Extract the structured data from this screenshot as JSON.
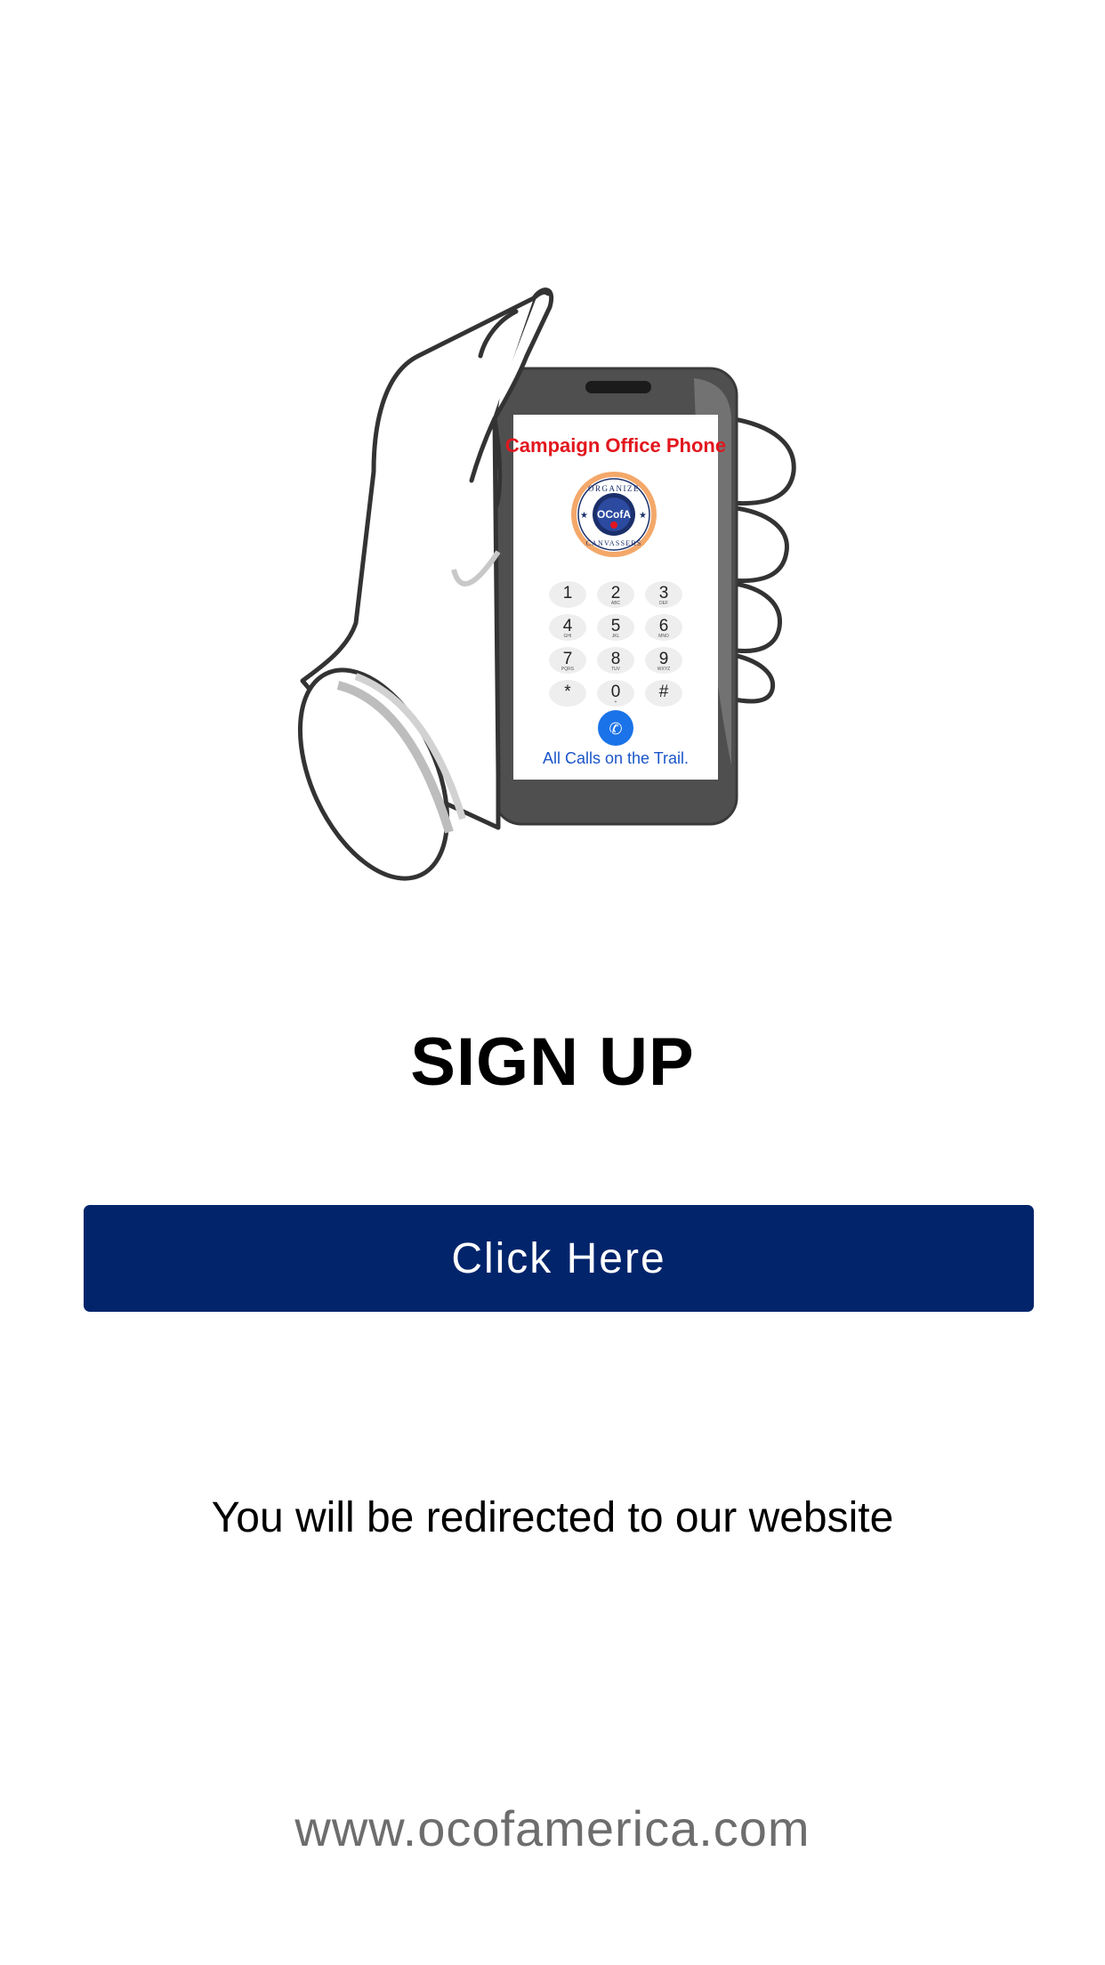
{
  "illustration": {
    "phone_title": "Campaign Office Phone",
    "phone_footer": "All Calls on the Trail.",
    "logo": {
      "ring_top_text": "ORGANIZE",
      "ring_bottom_text": "CANVASSERS",
      "center_text": "OCofA"
    },
    "keypad": [
      {
        "digit": "1",
        "letters": ""
      },
      {
        "digit": "2",
        "letters": "ABC"
      },
      {
        "digit": "3",
        "letters": "DEF"
      },
      {
        "digit": "4",
        "letters": "GHI"
      },
      {
        "digit": "5",
        "letters": "JKL"
      },
      {
        "digit": "6",
        "letters": "MNO"
      },
      {
        "digit": "7",
        "letters": "PQRS"
      },
      {
        "digit": "8",
        "letters": "TUV"
      },
      {
        "digit": "9",
        "letters": "WXYZ"
      },
      {
        "digit": "*",
        "letters": ""
      },
      {
        "digit": "0",
        "letters": "+"
      },
      {
        "digit": "#",
        "letters": ""
      }
    ],
    "colors": {
      "title_red": "#e2161d",
      "footer_blue": "#1a56c9",
      "call_button_blue": "#1a73e8"
    }
  },
  "signup": {
    "title": "SIGN UP"
  },
  "cta": {
    "label": "Click Here",
    "color": "#01246b"
  },
  "redirect_note": "You will be redirected to our website",
  "footer": {
    "url": "www.ocofamerica.com"
  }
}
